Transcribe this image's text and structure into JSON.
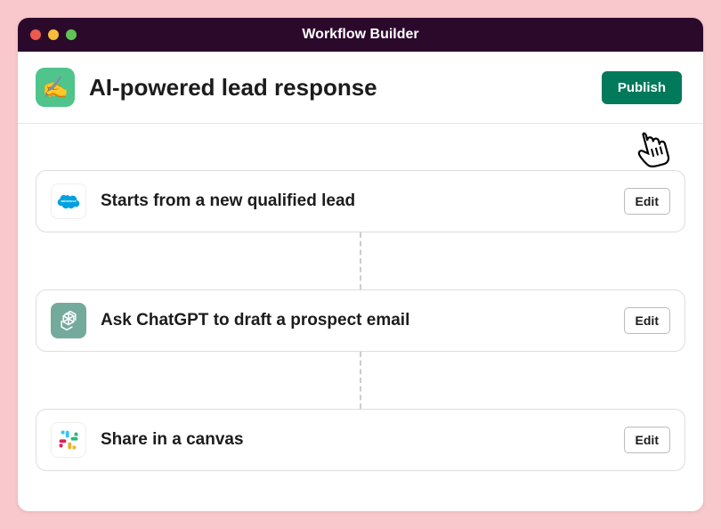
{
  "window": {
    "title": "Workflow Builder"
  },
  "workflow": {
    "icon_emoji": "✍️",
    "title": "AI-powered lead response",
    "publish_label": "Publish"
  },
  "steps": [
    {
      "icon": "salesforce-icon",
      "title": "Starts from a new qualified lead",
      "edit_label": "Edit"
    },
    {
      "icon": "openai-icon",
      "title": "Ask ChatGPT to draft a prospect email",
      "edit_label": "Edit"
    },
    {
      "icon": "slack-icon",
      "title": "Share in a canvas",
      "edit_label": "Edit"
    }
  ]
}
